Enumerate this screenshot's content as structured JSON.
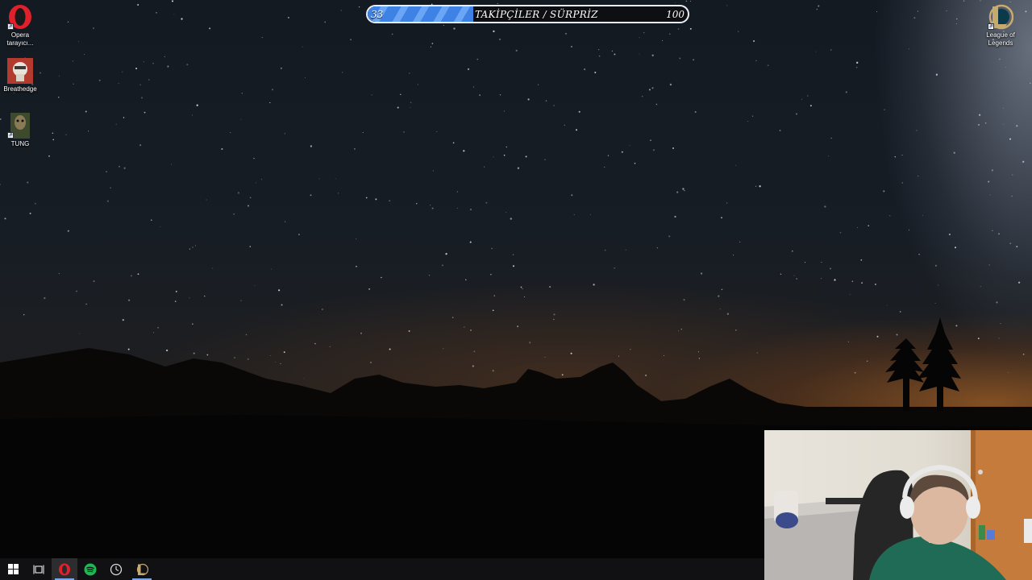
{
  "desktop": {
    "icons": [
      {
        "label": "Opera tarayıcı...",
        "icon": "opera-icon"
      },
      {
        "label": "Breathedge",
        "icon": "breathedge-icon"
      },
      {
        "label": "TUNG",
        "icon": "tung-icon"
      },
      {
        "label": "League of Legends",
        "icon": "league-of-legends-icon"
      }
    ]
  },
  "goal_bar": {
    "current": "33",
    "label": "TAKİPÇİLER / SÜRPRİZ",
    "target": "100",
    "progress": 0.33,
    "fill_color": "#3f82e6"
  },
  "taskbar": {
    "items": [
      {
        "name": "start",
        "icon": "windows-logo-icon"
      },
      {
        "name": "task-view",
        "icon": "task-view-icon"
      },
      {
        "name": "opera",
        "icon": "opera-icon",
        "active": true
      },
      {
        "name": "spotify",
        "icon": "spotify-icon"
      },
      {
        "name": "steam-like",
        "icon": "clock-app-icon"
      },
      {
        "name": "league-of-legends",
        "icon": "league-of-legends-icon"
      }
    ]
  },
  "colors": {
    "accent": "#3f82e6",
    "spotify": "#1db954",
    "opera": "#e0202a",
    "league_gold": "#c8aa6e"
  }
}
